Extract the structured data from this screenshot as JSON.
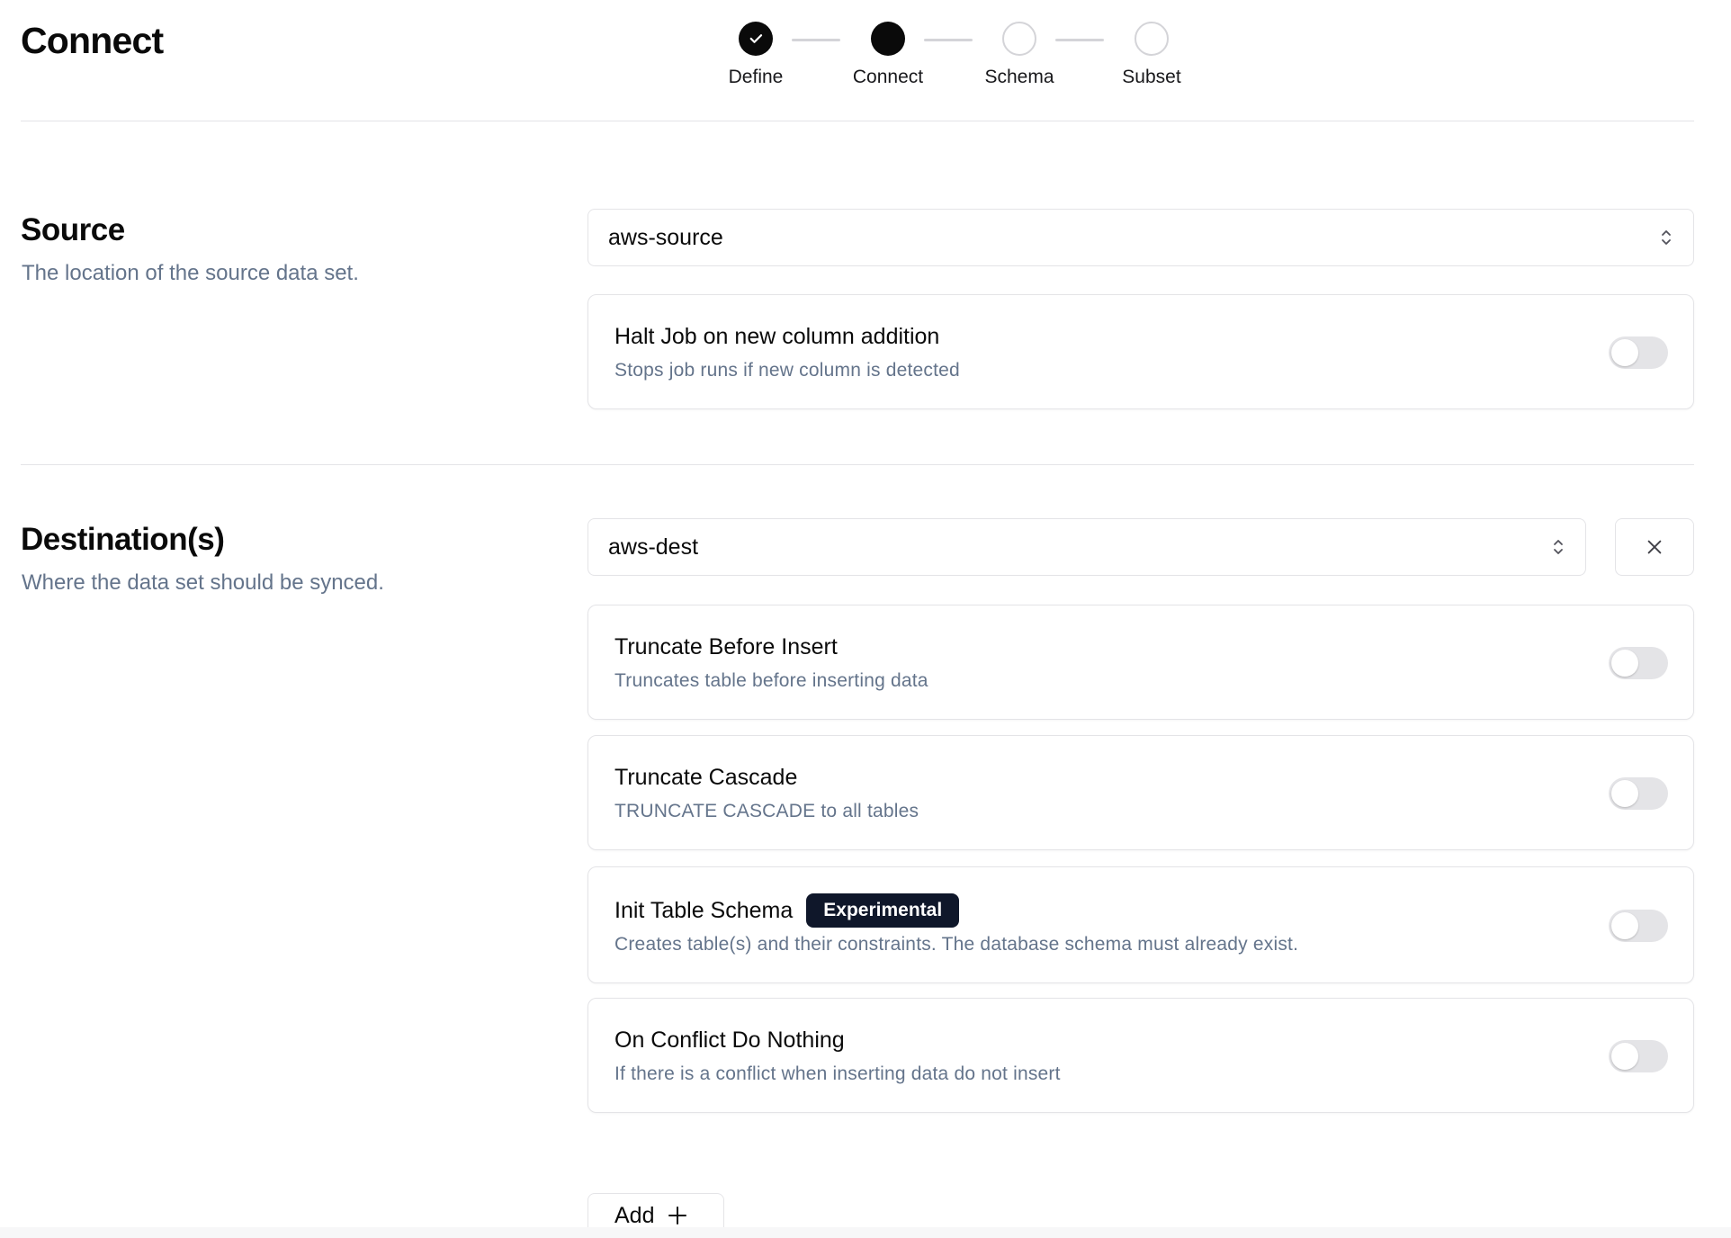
{
  "header": {
    "title": "Connect"
  },
  "stepper": {
    "steps": [
      {
        "label": "Define",
        "state": "completed"
      },
      {
        "label": "Connect",
        "state": "current"
      },
      {
        "label": "Schema",
        "state": "upcoming"
      },
      {
        "label": "Subset",
        "state": "upcoming"
      }
    ]
  },
  "source": {
    "title": "Source",
    "description": "The location of the source data set.",
    "selected": "aws-source",
    "options": [
      {
        "title": "Halt Job on new column addition",
        "description": "Stops job runs if new column is detected",
        "enabled": false
      }
    ]
  },
  "destination": {
    "title": "Destination(s)",
    "description": "Where the data set should be synced.",
    "selected": "aws-dest",
    "options": [
      {
        "title": "Truncate Before Insert",
        "description": "Truncates table before inserting data",
        "enabled": false
      },
      {
        "title": "Truncate Cascade",
        "description": "TRUNCATE CASCADE to all tables",
        "enabled": false
      },
      {
        "title": "Init Table Schema",
        "badge": "Experimental",
        "description": "Creates table(s) and their constraints. The database schema must already exist.",
        "enabled": false
      },
      {
        "title": "On Conflict Do Nothing",
        "description": "If there is a conflict when inserting data do not insert",
        "enabled": false
      }
    ],
    "add_label": "Add"
  },
  "icons": {
    "check": "check-icon",
    "chevrons": "chevrons-up-down-icon",
    "close": "close-icon",
    "plus": "plus-icon"
  },
  "colors": {
    "primary": "#0a0a0a",
    "muted_text": "#64748b",
    "border": "#e4e4e7",
    "badge_bg": "#0f172a",
    "toggle_off": "#e4e4e7"
  }
}
